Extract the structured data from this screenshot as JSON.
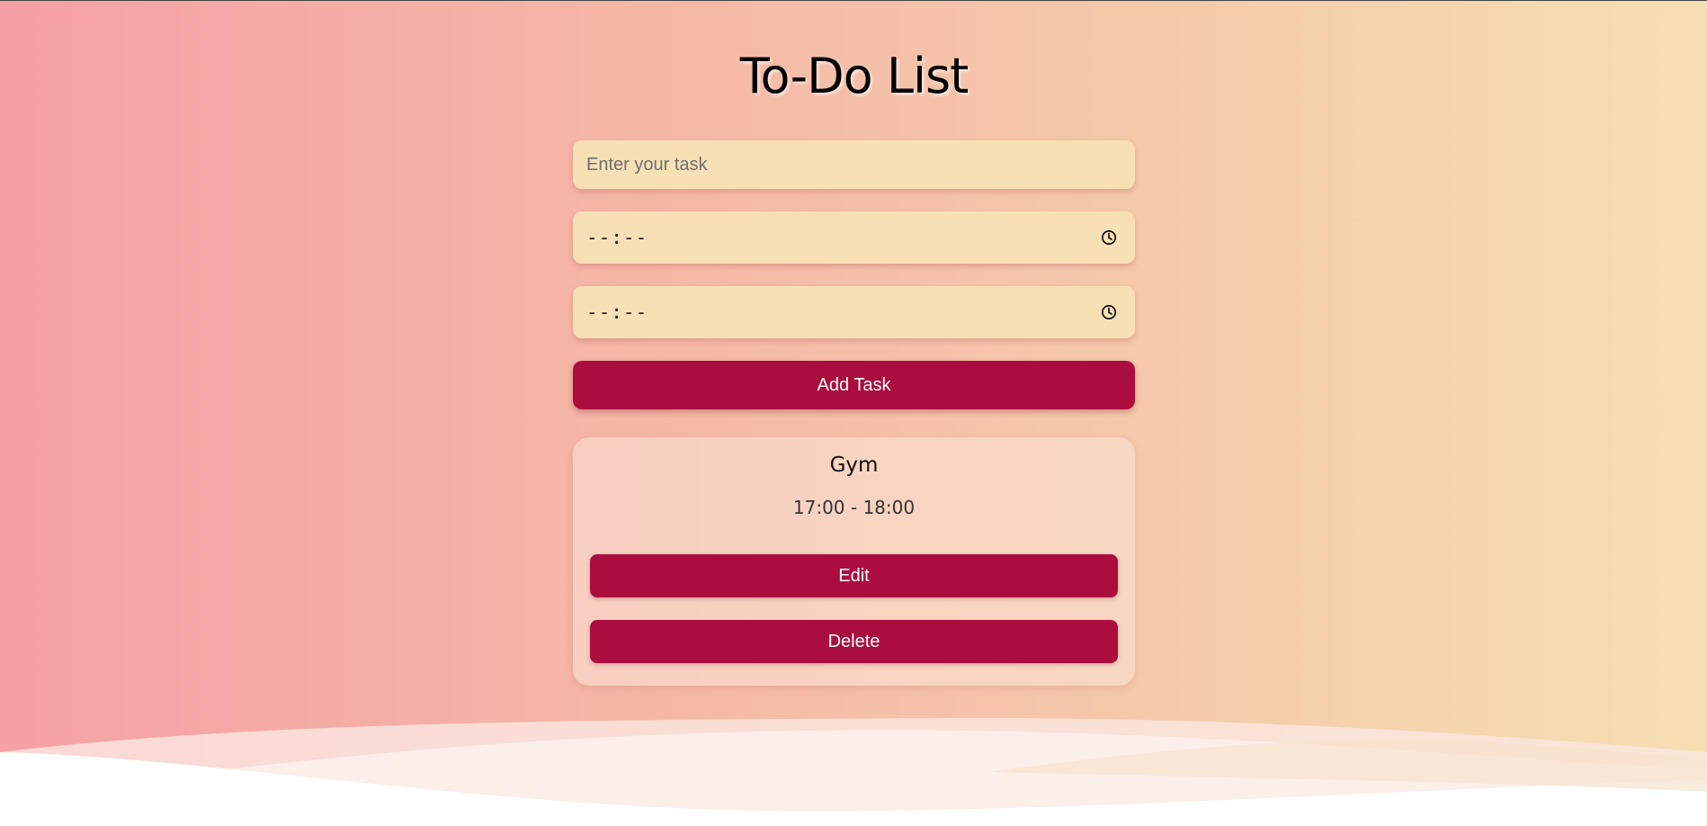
{
  "page": {
    "title": "To-Do List"
  },
  "form": {
    "task_placeholder": "Enter your task",
    "start_time_display": "--:--",
    "end_time_display": "--:--",
    "add_button_label": "Add Task"
  },
  "tasks": [
    {
      "name": "Gym",
      "time": "17:00 - 18:00",
      "edit_label": "Edit",
      "delete_label": "Delete"
    }
  ],
  "colors": {
    "accent": "#ab0d3f",
    "input_bg": "#f7e0b6",
    "gradient_start": "#f5a0a4",
    "gradient_end": "#f6dfb2"
  },
  "icons": {
    "time_picker": "clock-icon"
  }
}
